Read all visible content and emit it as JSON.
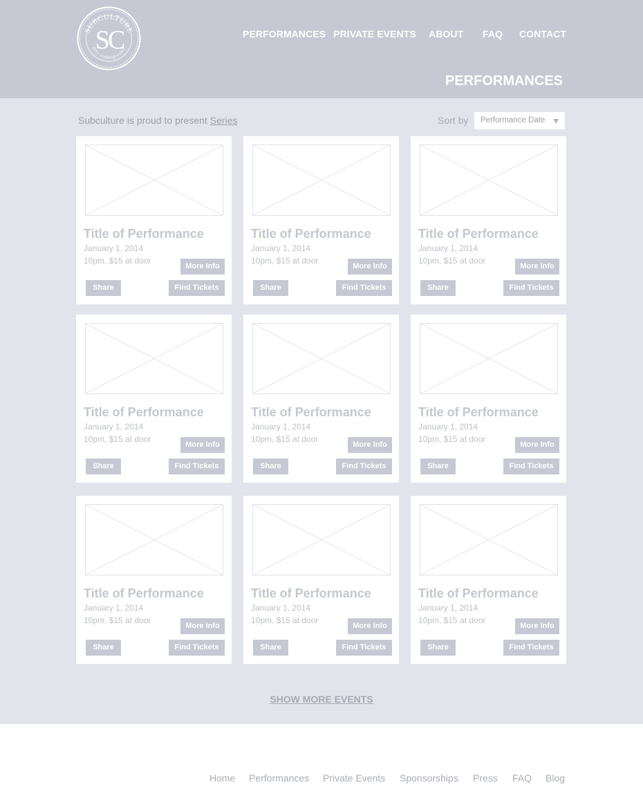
{
  "logo": {
    "monogram": "SC",
    "arc_top": "SUBCULTURE",
    "arc_bottom": "arts underground"
  },
  "nav": {
    "items": [
      {
        "label": "PERFORMANCES"
      },
      {
        "label": "PRIVATE EVENTS"
      },
      {
        "label": "ABOUT"
      },
      {
        "label": "FAQ"
      },
      {
        "label": "CONTACT"
      }
    ]
  },
  "page_heading": "PERFORMANCES",
  "intro": {
    "text": "Subculture is proud to present ",
    "link": "Series"
  },
  "sort": {
    "label": "Sort by",
    "selected": "Performance Date",
    "icon": "chevron-down-icon"
  },
  "cards": [
    {
      "image": "image-placeholder",
      "title": "Title of Performance",
      "date": "January 1, 2014",
      "details": "10pm, $15 at door",
      "more_info": "More Info",
      "share": "Share",
      "tickets": "Find Tickets"
    },
    {
      "image": "image-placeholder",
      "title": "Title of Performance",
      "date": "January 1, 2014",
      "details": "10pm, $15 at door",
      "more_info": "More Info",
      "share": "Share",
      "tickets": "Find Tickets"
    },
    {
      "image": "image-placeholder",
      "title": "Title of Performance",
      "date": "January 1, 2014",
      "details": "10pm, $15 at door",
      "more_info": "More Info",
      "share": "Share",
      "tickets": "Find Tickets"
    },
    {
      "image": "image-placeholder",
      "title": "Title of Performance",
      "date": "January 1, 2014",
      "details": "10pm, $15 at door",
      "more_info": "More Info",
      "share": "Share",
      "tickets": "Find Tickets"
    },
    {
      "image": "image-placeholder",
      "title": "Title of Performance",
      "date": "January 1, 2014",
      "details": "10pm, $15 at door",
      "more_info": "More Info",
      "share": "Share",
      "tickets": "Find Tickets"
    },
    {
      "image": "image-placeholder",
      "title": "Title of Performance",
      "date": "January 1, 2014",
      "details": "10pm, $15 at door",
      "more_info": "More Info",
      "share": "Share",
      "tickets": "Find Tickets"
    },
    {
      "image": "image-placeholder",
      "title": "Title of Performance",
      "date": "January 1, 2014",
      "details": "10pm, $15 at door",
      "more_info": "More Info",
      "share": "Share",
      "tickets": "Find Tickets"
    },
    {
      "image": "image-placeholder",
      "title": "Title of Performance",
      "date": "January 1, 2014",
      "details": "10pm, $15 at door",
      "more_info": "More Info",
      "share": "Share",
      "tickets": "Find Tickets"
    },
    {
      "image": "image-placeholder",
      "title": "Title of Performance",
      "date": "January 1, 2014",
      "details": "10pm, $15 at door",
      "more_info": "More Info",
      "share": "Share",
      "tickets": "Find Tickets"
    }
  ],
  "show_more": "SHOW MORE EVENTS",
  "footer": {
    "links": [
      {
        "label": "Home"
      },
      {
        "label": "Performances"
      },
      {
        "label": "Private Events"
      },
      {
        "label": "Sponsorships"
      },
      {
        "label": "Press"
      },
      {
        "label": "FAQ"
      },
      {
        "label": "Blog"
      }
    ]
  },
  "colors": {
    "header_bg": "#c6c9d3",
    "main_bg": "#e2e4eb",
    "button_bg": "#c6c9d3",
    "card_bg": "#ffffff",
    "muted_text": "#9da0aa"
  }
}
